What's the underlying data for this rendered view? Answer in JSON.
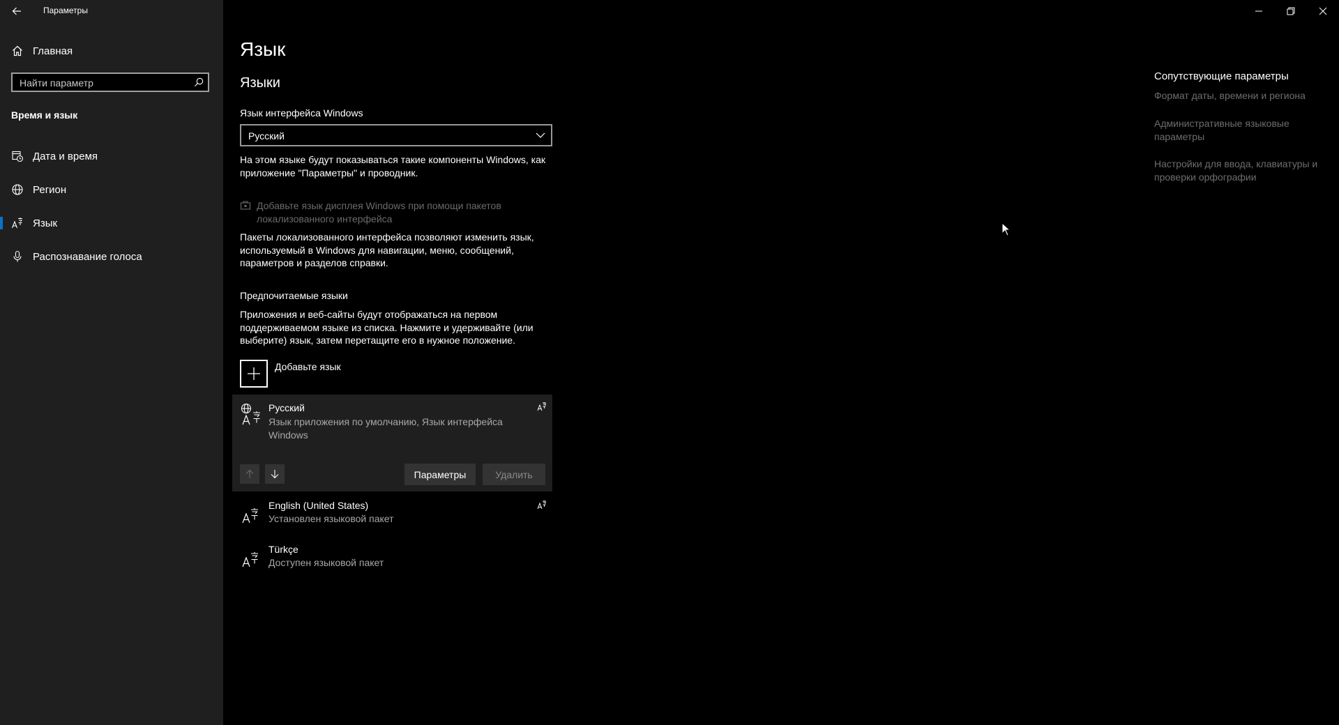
{
  "window": {
    "title": "Параметры",
    "controls": {
      "minimize": "minimize-icon",
      "restore": "restore-icon",
      "close": "close-icon"
    }
  },
  "sidebar": {
    "home": {
      "label": "Главная",
      "icon": "home-icon"
    },
    "search": {
      "placeholder": "Найти параметр",
      "icon": "search-icon"
    },
    "section": "Время и язык",
    "items": [
      {
        "label": "Дата и время",
        "icon": "calendar-clock-icon",
        "active": false
      },
      {
        "label": "Регион",
        "icon": "globe-icon",
        "active": false
      },
      {
        "label": "Язык",
        "icon": "language-icon",
        "active": true
      },
      {
        "label": "Распознавание голоса",
        "icon": "microphone-icon",
        "active": false
      }
    ]
  },
  "main": {
    "page_title": "Язык",
    "section_title": "Языки",
    "display_language": {
      "label": "Язык интерфейса Windows",
      "selected": "Русский",
      "description_line1": "На этом языке будут показываться такие компоненты Windows, как",
      "description_line2": "приложение \"Параметры\" и проводник."
    },
    "lip_link": {
      "line1": "Добавьте язык дисплея Windows при помощи пакетов",
      "line2": "локализованного интерфейса",
      "icon": "store-bag-icon"
    },
    "lip_description": {
      "line1": "Пакеты локализованного интерфейса позволяют изменить язык,",
      "line2": "используемый в Windows для навигации, меню, сообщений,",
      "line3": "параметров и разделов справки."
    },
    "preferred": {
      "title": "Предпочитаемые языки",
      "line1": "Приложения и веб-сайты будут отображаться на первом",
      "line2": "поддерживаемом языке из списка. Нажмите и удерживайте (или",
      "line3": "выберите) язык, затем перетащите его в нужное положение.",
      "add_label": "Добавьте язык"
    },
    "languages": [
      {
        "name": "Русский",
        "desc_line1": "Язык приложения по умолчанию, Язык интерфейса",
        "desc_line2": "Windows",
        "selected": true
      },
      {
        "name": "English (United States)",
        "desc_line1": "Установлен языковой пакет",
        "selected": false
      },
      {
        "name": "Türkçe",
        "desc_line1": "Доступен языковой пакет",
        "selected": false
      }
    ],
    "buttons": {
      "options": "Параметры",
      "remove": "Удалить"
    }
  },
  "related": {
    "title": "Сопутствующие параметры",
    "link1": "Формат даты, времени и региона",
    "link2_line1": "Административные языковые",
    "link2_line2": "параметры",
    "link3_line1": "Настройки для ввода, клавиатуры и",
    "link3_line2": "проверки орфографии"
  },
  "colors": {
    "sidebar_bg": "#1f1f1f",
    "main_bg": "#000000",
    "accent": "#0a72c9",
    "button_bg": "#333333",
    "muted_text": "#8c8c8c"
  }
}
